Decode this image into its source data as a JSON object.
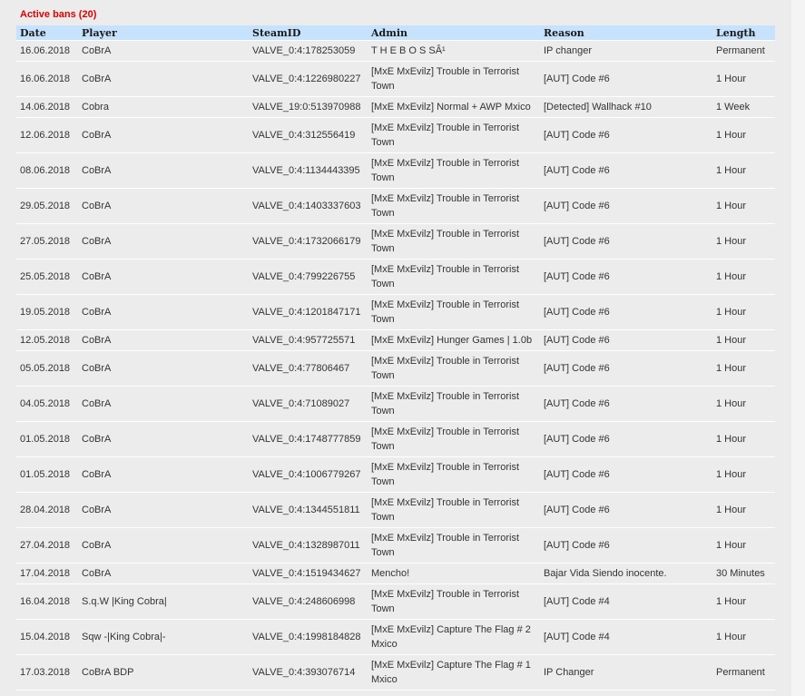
{
  "title": "Active bans (20)",
  "columns": [
    "Date",
    "Player",
    "SteamID",
    "Admin",
    "Reason",
    "Length"
  ],
  "rows": [
    {
      "date": "16.06.2018",
      "player": "CoBrA",
      "steamid": "VALVE_0:4:178253059",
      "admin": "T H E B O S SÂ¹",
      "reason": "IP changer",
      "length": "Permanent"
    },
    {
      "date": "16.06.2018",
      "player": "CoBrA",
      "steamid": "VALVE_0:4:1226980227",
      "admin": "[MxE MxEvilz] Trouble in Terrorist Town",
      "reason": "[AUT] Code #6",
      "length": "1 Hour"
    },
    {
      "date": "14.06.2018",
      "player": "Cobra",
      "steamid": "VALVE_19:0:513970988",
      "admin": "[MxE MxEvilz] Normal + AWP Mxico",
      "reason": "[Detected] Wallhack #10",
      "length": "1 Week"
    },
    {
      "date": "12.06.2018",
      "player": "CoBrA",
      "steamid": "VALVE_0:4:312556419",
      "admin": "[MxE MxEvilz] Trouble in Terrorist Town",
      "reason": "[AUT] Code #6",
      "length": "1 Hour"
    },
    {
      "date": "08.06.2018",
      "player": "CoBrA",
      "steamid": "VALVE_0:4:1134443395",
      "admin": "[MxE MxEvilz] Trouble in Terrorist Town",
      "reason": "[AUT] Code #6",
      "length": "1 Hour"
    },
    {
      "date": "29.05.2018",
      "player": "CoBrA",
      "steamid": "VALVE_0:4:1403337603",
      "admin": "[MxE MxEvilz] Trouble in Terrorist Town",
      "reason": "[AUT] Code #6",
      "length": "1 Hour"
    },
    {
      "date": "27.05.2018",
      "player": "CoBrA",
      "steamid": "VALVE_0:4:1732066179",
      "admin": "[MxE MxEvilz] Trouble in Terrorist Town",
      "reason": "[AUT] Code #6",
      "length": "1 Hour"
    },
    {
      "date": "25.05.2018",
      "player": "CoBrA",
      "steamid": "VALVE_0:4:799226755",
      "admin": "[MxE MxEvilz] Trouble in Terrorist Town",
      "reason": "[AUT] Code #6",
      "length": "1 Hour"
    },
    {
      "date": "19.05.2018",
      "player": "CoBrA",
      "steamid": "VALVE_0:4:1201847171",
      "admin": "[MxE MxEvilz] Trouble in Terrorist Town",
      "reason": "[AUT] Code #6",
      "length": "1 Hour"
    },
    {
      "date": "12.05.2018",
      "player": "CoBrA",
      "steamid": "VALVE_0:4:957725571",
      "admin": "[MxE MxEvilz] Hunger Games | 1.0b",
      "reason": "[AUT] Code #6",
      "length": "1 Hour"
    },
    {
      "date": "05.05.2018",
      "player": "CoBrA",
      "steamid": "VALVE_0:4:77806467",
      "admin": "[MxE MxEvilz] Trouble in Terrorist Town",
      "reason": "[AUT] Code #6",
      "length": "1 Hour"
    },
    {
      "date": "04.05.2018",
      "player": "CoBrA",
      "steamid": "VALVE_0:4:71089027",
      "admin": "[MxE MxEvilz] Trouble in Terrorist Town",
      "reason": "[AUT] Code #6",
      "length": "1 Hour"
    },
    {
      "date": "01.05.2018",
      "player": "CoBrA",
      "steamid": "VALVE_0:4:1748777859",
      "admin": "[MxE MxEvilz] Trouble in Terrorist Town",
      "reason": "[AUT] Code #6",
      "length": "1 Hour"
    },
    {
      "date": "01.05.2018",
      "player": "CoBrA",
      "steamid": "VALVE_0:4:1006779267",
      "admin": "[MxE MxEvilz] Trouble in Terrorist Town",
      "reason": "[AUT] Code #6",
      "length": "1 Hour"
    },
    {
      "date": "28.04.2018",
      "player": "CoBrA",
      "steamid": "VALVE_0:4:1344551811",
      "admin": "[MxE MxEvilz] Trouble in Terrorist Town",
      "reason": "[AUT] Code #6",
      "length": "1 Hour"
    },
    {
      "date": "27.04.2018",
      "player": "CoBrA",
      "steamid": "VALVE_0:4:1328987011",
      "admin": "[MxE MxEvilz] Trouble in Terrorist Town",
      "reason": "[AUT] Code #6",
      "length": "1 Hour"
    },
    {
      "date": "17.04.2018",
      "player": "CoBrA",
      "steamid": "VALVE_0:4:1519434627",
      "admin": "Mencho!",
      "reason": "Bajar Vida Siendo inocente.",
      "length": "30 Minutes"
    },
    {
      "date": "16.04.2018",
      "player": "S.q.W |King Cobra|",
      "steamid": "VALVE_0:4:248606998",
      "admin": "[MxE MxEvilz] Trouble in Terrorist Town",
      "reason": "[AUT] Code #4",
      "length": "1 Hour"
    },
    {
      "date": "15.04.2018",
      "player": "Sqw -|King Cobra|-",
      "steamid": "VALVE_0:4:1998184828",
      "admin": "[MxE MxEvilz] Capture The Flag # 2 Mxico",
      "reason": "[AUT] Code #4",
      "length": "1 Hour"
    },
    {
      "date": "17.03.2018",
      "player": "CoBrA BDP",
      "steamid": "VALVE_0:4:393076714",
      "admin": "[MxE MxEvilz] Capture The Flag # 1 Mxico",
      "reason": "IP Changer",
      "length": "Permanent"
    }
  ],
  "colors": {
    "title": "#e10000",
    "header_bg": "#c6e2fc",
    "page_bg": "#ececec",
    "row_separator": "#ffffff"
  }
}
